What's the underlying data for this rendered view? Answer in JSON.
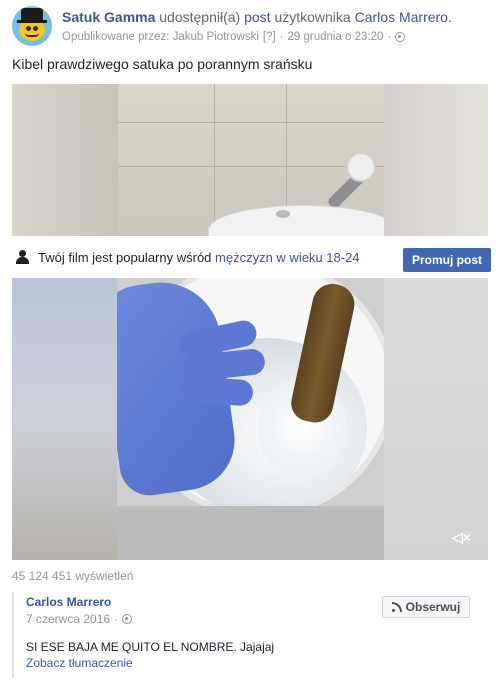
{
  "post": {
    "author": "Satuk Gamma",
    "shared_text": "udostępnił(a)",
    "post_link": "post",
    "owner_prefix": "użytkownika",
    "owner_name": "Carlos Marrero",
    "owner_suffix": ".",
    "published_by": "Opublikowane przez: Jakub Piotrowski",
    "published_marker": "[?]",
    "separator": "·",
    "date": "29 grudnia o 23:20",
    "caption": "Kibel prawdziwego satuka po porannym srańsku"
  },
  "promo": {
    "text": "Twój film jest popularny wśród",
    "audience": "mężczyzn w wieku 18-24",
    "button": "Promuj post"
  },
  "video": {
    "mute_icon": "volume-mute-icon",
    "mute_glyph": "◁×",
    "views": "45 124 451 wyświetleń"
  },
  "shared_post": {
    "author": "Carlos Marrero",
    "date": "7 czerwca 2016",
    "separator": "·",
    "follow_button": "Obserwuj",
    "text": "SI ESE BAJA ME QUITO EL NOMBRE. Jajajaj",
    "translate_link": "Zobacz tłumaczenie"
  },
  "colors": {
    "link": "#365899",
    "button": "#4267b2",
    "meta": "#90949c"
  }
}
